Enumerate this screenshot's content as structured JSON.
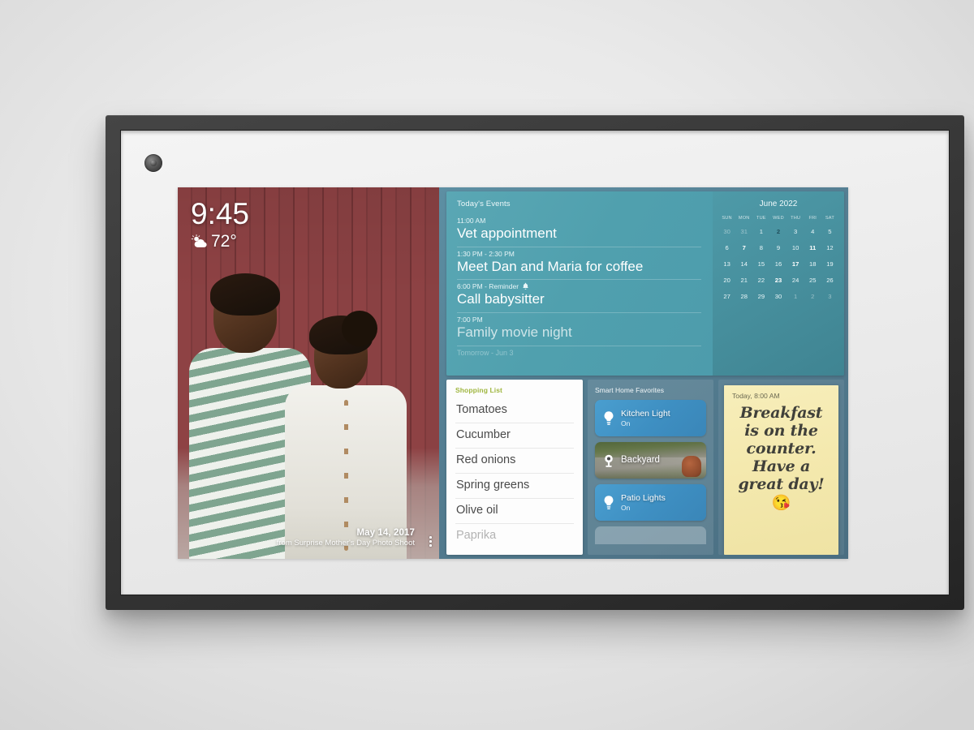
{
  "device": {
    "name": "Smart display in wall frame",
    "camera_icon": "camera-lens"
  },
  "photo": {
    "clock_time": "9:45",
    "weather_icon": "sun-behind-cloud-icon",
    "temperature": "72°",
    "date": "May 14, 2017",
    "source": "from Surprise Mother's Day Photo Shoot",
    "menu_icon": "overflow-menu-icon"
  },
  "events": {
    "title": "Today's Events",
    "items": [
      {
        "meta": "11:00 AM",
        "title": "Vet appointment",
        "icon": ""
      },
      {
        "meta": "1:30 PM - 2:30 PM",
        "title": "Meet Dan and Maria for coffee",
        "icon": ""
      },
      {
        "meta": "6:00 PM - Reminder",
        "title": "Call babysitter",
        "icon": "bell-icon"
      },
      {
        "meta": "7:00 PM",
        "title": "Family movie night",
        "icon": ""
      }
    ],
    "next_section_label": "Tomorrow - Jun 3"
  },
  "calendar": {
    "month": "June 2022",
    "dow": [
      "SUN",
      "MON",
      "TUE",
      "WED",
      "THU",
      "FRI",
      "SAT"
    ],
    "weeks": [
      [
        {
          "d": "30",
          "dim": true
        },
        {
          "d": "31",
          "dim": true
        },
        {
          "d": "1"
        },
        {
          "d": "2",
          "today": true
        },
        {
          "d": "3"
        },
        {
          "d": "4"
        },
        {
          "d": "5"
        }
      ],
      [
        {
          "d": "6"
        },
        {
          "d": "7",
          "evt": true
        },
        {
          "d": "8"
        },
        {
          "d": "9"
        },
        {
          "d": "10"
        },
        {
          "d": "11",
          "evt": true
        },
        {
          "d": "12"
        }
      ],
      [
        {
          "d": "13"
        },
        {
          "d": "14"
        },
        {
          "d": "15"
        },
        {
          "d": "16"
        },
        {
          "d": "17",
          "evt": true
        },
        {
          "d": "18"
        },
        {
          "d": "19"
        }
      ],
      [
        {
          "d": "20"
        },
        {
          "d": "21"
        },
        {
          "d": "22"
        },
        {
          "d": "23",
          "evt": true
        },
        {
          "d": "24"
        },
        {
          "d": "25"
        },
        {
          "d": "26"
        }
      ],
      [
        {
          "d": "27"
        },
        {
          "d": "28"
        },
        {
          "d": "29"
        },
        {
          "d": "30"
        },
        {
          "d": "1",
          "dim": true
        },
        {
          "d": "2",
          "dim": true
        },
        {
          "d": "3",
          "dim": true
        }
      ]
    ],
    "today_date": "2"
  },
  "shopping": {
    "title": "Shopping List",
    "items": [
      {
        "label": "Tomatoes"
      },
      {
        "label": "Cucumber"
      },
      {
        "label": "Red onions"
      },
      {
        "label": "Spring greens"
      },
      {
        "label": "Olive oil"
      },
      {
        "label": "Paprika",
        "faded": true
      }
    ]
  },
  "smarthome": {
    "title": "Smart Home Favorites",
    "tiles": [
      {
        "name": "Kitchen Light",
        "state": "On",
        "icon": "lightbulb-icon",
        "kind": "light"
      },
      {
        "name": "Backyard",
        "state": "",
        "icon": "camera-icon",
        "kind": "camera"
      },
      {
        "name": "Patio Lights",
        "state": "On",
        "icon": "lightbulb-icon",
        "kind": "light"
      },
      {
        "name": "",
        "state": "",
        "icon": "",
        "kind": "partial"
      }
    ]
  },
  "note": {
    "timestamp": "Today, 8:00 AM",
    "lines": [
      "Breakfast",
      "is on the",
      "counter.",
      "Have a",
      "great day!"
    ],
    "emoji": "😘"
  },
  "colors": {
    "wall": "#e8e8e8",
    "frame": "#3a3a3a",
    "events_teal": "#50a0ae",
    "calendar_teal": "#468e9c",
    "widget_bg": "#557f93",
    "today_highlight": "#7ed4e6",
    "shopping_accent": "#9fb63f",
    "note_paper": "#f4e9ae",
    "tile_blue": "#3e8fc2"
  }
}
